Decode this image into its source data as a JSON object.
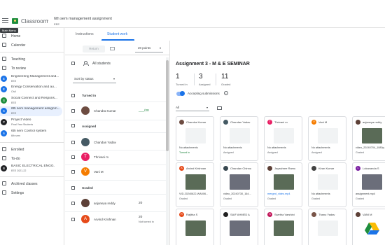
{
  "header": {
    "app_title": "Classroom",
    "class_name": "6th sem management assignment",
    "class_section": "EEE",
    "tooltip": "Main Menu"
  },
  "tabs": [
    {
      "label": "Instructions",
      "active": false
    },
    {
      "label": "Student work",
      "active": true
    }
  ],
  "sidebar": {
    "nav_top": [
      {
        "label": "Home",
        "icon": "home-icon"
      },
      {
        "label": "Calendar",
        "icon": "calendar-icon"
      }
    ],
    "teaching_label": "Teaching",
    "to_review_label": "To review",
    "classes": [
      {
        "initial": "E",
        "name": "Engineering Management and...",
        "section": "EEE",
        "color": "#1a73e8"
      },
      {
        "initial": "E",
        "name": "Energy Conservation and au...",
        "section": "Civil",
        "color": "#1a73e8"
      },
      {
        "initial": "S",
        "name": "Social Connect and Respons...",
        "section": "EEE",
        "color": "#1e8e3e"
      },
      {
        "initial": "6",
        "name": "6th sem management assignm...",
        "section": "EEE",
        "color": "#1a73e8"
      },
      {
        "initial": "P",
        "name": "Project Video",
        "section": "Final Year Students",
        "color": "#202124"
      },
      {
        "initial": "6",
        "name": "6th sem Control system",
        "section": "6th sem",
        "color": "#1a73e8"
      }
    ],
    "enrolled_label": "Enrolled",
    "todo_label": "To-do",
    "enrolled_class": {
      "initial": "B",
      "name": "BASIC ELECTRICAL ENGG.",
      "section": "EEE 2021-22",
      "color": "#202124"
    },
    "archived_label": "Archived classes",
    "settings_label": "Settings"
  },
  "student_list": {
    "return_label": "Return",
    "points": "20 points",
    "all_students": "All students",
    "sort": "Sort by status",
    "groups": {
      "turned_in": "Turned in",
      "assigned": "Assigned",
      "graded": "Graded"
    },
    "turned_in": [
      {
        "name": "Chandra Kumar",
        "grade": "___/20",
        "avatar": "photo",
        "color": "#6d4c41"
      }
    ],
    "assigned": [
      {
        "name": "Chandan Yadav",
        "avatar": "photo",
        "color": "#455a64"
      },
      {
        "name": "Thrivani m",
        "avatar": "T",
        "color": "#e91e63"
      },
      {
        "name": "Vani M",
        "avatar": "V",
        "color": "#f57c00"
      }
    ],
    "graded": [
      {
        "name": "anjaneya reddy",
        "grade": "20",
        "sub": "",
        "avatar": "photo",
        "color": "#5d4037"
      },
      {
        "name": "Arvind Krishnan",
        "grade": "20",
        "sub": "Not turned in",
        "avatar": "A",
        "color": "#e64a19"
      }
    ]
  },
  "assignment": {
    "title": "Assignment 3 - M & E SEMINAR",
    "stats": [
      {
        "num": "1",
        "label": "Turned in"
      },
      {
        "num": "3",
        "label": "Assigned"
      },
      {
        "num": "11",
        "label": "Graded"
      }
    ],
    "accepting": "Accepting submissions",
    "filter": "All",
    "cards": [
      {
        "name": "Chandra Kumar",
        "text": "No attachments",
        "status": "Turned in",
        "av": "photo",
        "color": "#6d4c41",
        "thumb": "blank",
        "status_color": "green"
      },
      {
        "name": "Chandan Yadav",
        "text": "No attachments",
        "status": "Assigned",
        "av": "photo",
        "color": "#455a64",
        "thumb": "blank",
        "status_color": "grey"
      },
      {
        "name": "Thrivani m",
        "text": "No attachments",
        "status": "Assigned",
        "av": "T",
        "color": "#e91e63",
        "thumb": "blank",
        "status_color": "grey"
      },
      {
        "name": "Vani M",
        "text": "No attachments",
        "status": "Assigned",
        "av": "V",
        "color": "#f57c00",
        "thumb": "blank",
        "status_color": "grey"
      },
      {
        "name": "anjaneya reddy",
        "text": "video_20240704_1080p...",
        "status": "Graded",
        "av": "photo",
        "color": "#5d4037",
        "thumb": "img",
        "status_color": "grey"
      },
      {
        "name": "Arvind Krishnan",
        "text": "VID-20240622-WA006...",
        "status": "Graded",
        "av": "A",
        "color": "#e64a19",
        "thumb": "img",
        "status_color": "grey"
      },
      {
        "name": "Chandan Chinnu",
        "text": "video_20240730_164...",
        "status": "Graded",
        "av": "photo",
        "color": "#37474f",
        "thumb": "img2",
        "status_color": "grey"
      },
      {
        "name": "Jayashree Ramu",
        "text": "merged_video.mp4",
        "status": "Graded",
        "av": "photo",
        "color": "#5d4037",
        "thumb": "img",
        "status_color": "grey",
        "link": true
      },
      {
        "name": "Kiran Kumar",
        "text": "No attachments",
        "status": "Graded",
        "av": "photo",
        "color": "#424242",
        "thumb": "blank",
        "status_color": "grey"
      },
      {
        "name": "Lokananda S",
        "text": "assignment.mp4",
        "status": "Graded",
        "av": "L",
        "color": "#7b1fa2",
        "thumb": "img2",
        "status_color": "grey"
      },
      {
        "name": "Rajitha S",
        "text": "",
        "status": "",
        "av": "R",
        "color": "#e64a19",
        "thumb": "img",
        "status_color": "grey"
      },
      {
        "name": "SAIF AHMED A",
        "text": "",
        "status": "",
        "av": "photo",
        "color": "#212121",
        "thumb": "img2",
        "status_color": "grey"
      },
      {
        "name": "Swetha Varshini",
        "text": "",
        "status": "",
        "av": "S",
        "color": "#c2185b",
        "thumb": "img",
        "status_color": "grey"
      },
      {
        "name": "Thanu Yadav",
        "text": "",
        "status": "",
        "av": "photo",
        "color": "#795548",
        "thumb": "blank",
        "status_color": "grey"
      },
      {
        "name": "VANI M",
        "text": "",
        "status": "",
        "av": "photo",
        "color": "#5d4037",
        "thumb": "drive",
        "status_color": "grey"
      }
    ]
  }
}
